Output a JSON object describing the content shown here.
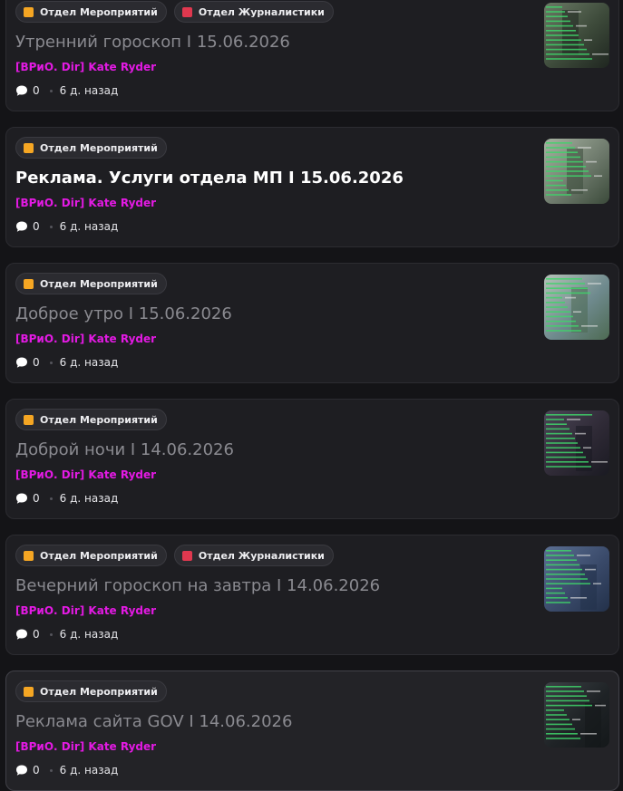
{
  "colors": {
    "background": "#141417",
    "card_background": "#1e1e22",
    "author": "#e31ae3",
    "title_muted": "#8a8a90",
    "title_active": "#ffffff",
    "tag_events": "#f5a623",
    "tag_journalism": "#e0384f"
  },
  "posts": [
    {
      "tags": [
        {
          "label": "Отдел Мероприятий",
          "icon": "orange-square-icon"
        },
        {
          "label": "Отдел Журналистики",
          "icon": "red-book-icon"
        }
      ],
      "title": "Утренний гороскоп I 15.06.2026",
      "author": "[ВРиО. Dir] Kate Ryder",
      "comments": "0",
      "time": "6 д. назад",
      "thumbnail": "game-chat-screenshot"
    },
    {
      "tags": [
        {
          "label": "Отдел Мероприятий",
          "icon": "orange-square-icon"
        }
      ],
      "title": "Реклама. Услуги отдела МП I 15.06.2026",
      "author": "[ВРиО. Dir] Kate Ryder",
      "comments": "0",
      "time": "6 д. назад",
      "thumbnail": "game-chat-screenshot"
    },
    {
      "tags": [
        {
          "label": "Отдел Мероприятий",
          "icon": "orange-square-icon"
        }
      ],
      "title": "Доброе утро I 15.06.2026",
      "author": "[ВРиО. Dir] Kate Ryder",
      "comments": "0",
      "time": "6 д. назад",
      "thumbnail": "game-chat-screenshot"
    },
    {
      "tags": [
        {
          "label": "Отдел Мероприятий",
          "icon": "orange-square-icon"
        }
      ],
      "title": "Доброй ночи I 14.06.2026",
      "author": "[ВРиО. Dir] Kate Ryder",
      "comments": "0",
      "time": "6 д. назад",
      "thumbnail": "game-chat-screenshot"
    },
    {
      "tags": [
        {
          "label": "Отдел Мероприятий",
          "icon": "orange-square-icon"
        },
        {
          "label": "Отдел Журналистики",
          "icon": "red-book-icon"
        }
      ],
      "title": "Вечерний гороскоп на завтра I 14.06.2026",
      "author": "[ВРиО. Dir] Kate Ryder",
      "comments": "0",
      "time": "6 д. назад",
      "thumbnail": "game-chat-screenshot"
    },
    {
      "tags": [
        {
          "label": "Отдел Мероприятий",
          "icon": "orange-square-icon"
        }
      ],
      "title": "Реклама сайта GOV I 14.06.2026",
      "author": "[ВРиО. Dir] Kate Ryder",
      "comments": "0",
      "time": "6 д. назад",
      "thumbnail": "game-chat-screenshot"
    }
  ]
}
